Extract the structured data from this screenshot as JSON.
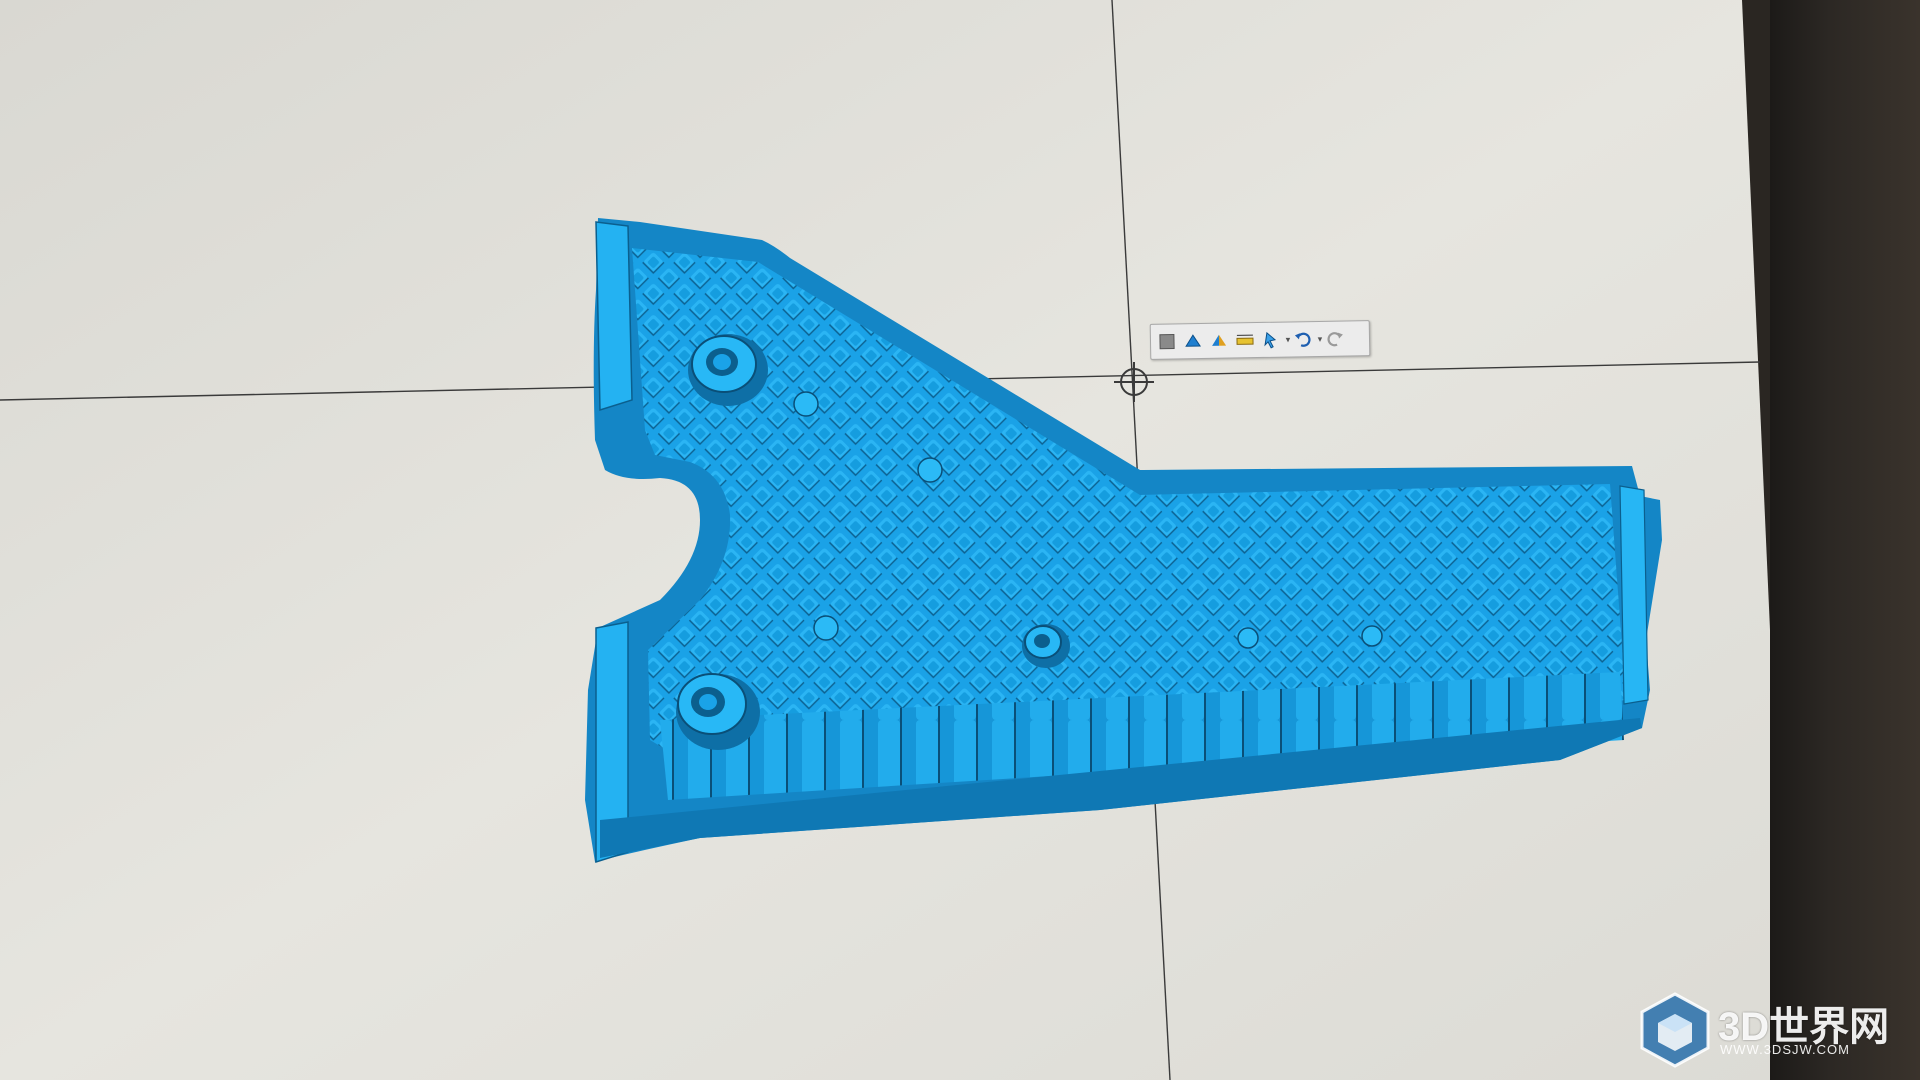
{
  "viewport": {
    "background_color": "#e4e2dc",
    "model_color": "#1aa3e8",
    "crosshair_color": "#3a3a3a"
  },
  "mini_toolbar": {
    "icons": [
      "view-icon",
      "section-icon",
      "split-view-icon",
      "measure-icon",
      "select-icon",
      "undo-icon",
      "redo-icon"
    ]
  },
  "watermark": {
    "title": "3D世界网",
    "url": "WWW.3DSJW.COM"
  }
}
